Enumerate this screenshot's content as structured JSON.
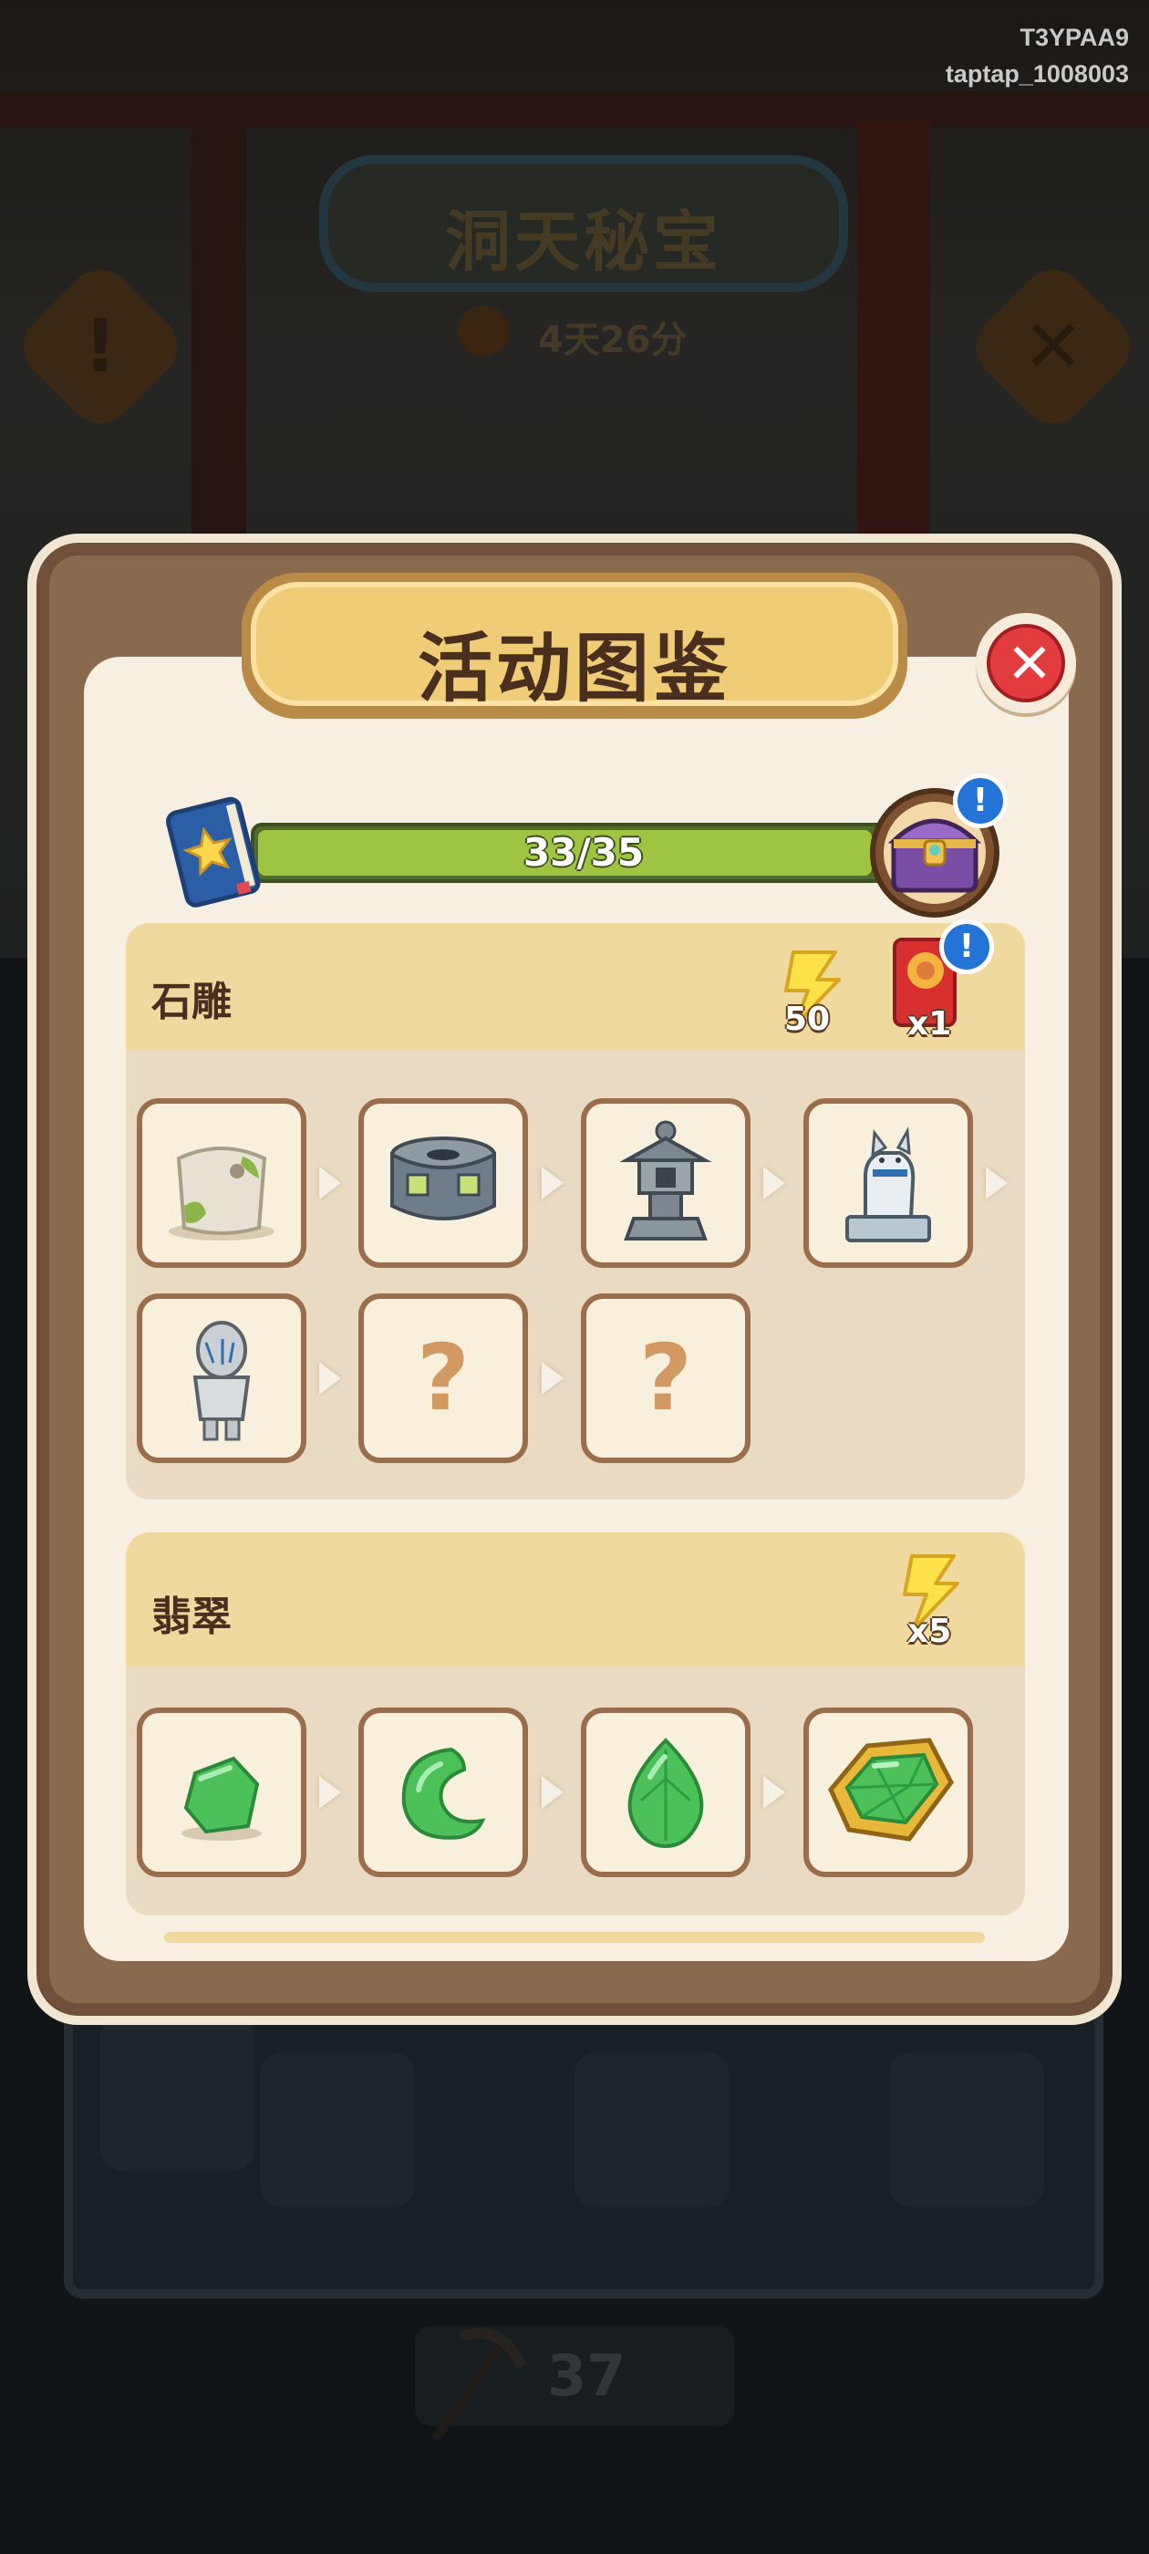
{
  "device_ids": {
    "line1": "T3YPAA9",
    "line2": "taptap_1008003"
  },
  "background": {
    "event_title": "洞天秘宝",
    "timer": "4天26分",
    "pickaxe_count": "37"
  },
  "modal": {
    "title": "活动图鉴",
    "progress": {
      "current": 33,
      "total": 35,
      "label": "33/35"
    },
    "sections": [
      {
        "name": "石雕",
        "rewards": [
          {
            "icon": "lightning-energy-icon",
            "label": "50"
          },
          {
            "icon": "red-envelope-icon",
            "label": "x1"
          }
        ],
        "items": [
          {
            "icon": "mossy-stone-block-icon",
            "unlocked": true
          },
          {
            "icon": "carved-stone-drum-icon",
            "unlocked": true
          },
          {
            "icon": "stone-lantern-icon",
            "unlocked": true
          },
          {
            "icon": "stone-dog-statue-icon",
            "unlocked": true
          },
          {
            "icon": "stone-figure-statue-icon",
            "unlocked": true
          },
          {
            "icon": "unknown-item-icon",
            "unlocked": false,
            "label": "?"
          },
          {
            "icon": "unknown-item-icon",
            "unlocked": false,
            "label": "?"
          }
        ]
      },
      {
        "name": "翡翠",
        "rewards": [
          {
            "icon": "lightning-energy-icon",
            "label": "x5"
          }
        ],
        "items": [
          {
            "icon": "jade-pebble-icon",
            "unlocked": true
          },
          {
            "icon": "jade-crescent-icon",
            "unlocked": true
          },
          {
            "icon": "jade-drop-icon",
            "unlocked": true
          },
          {
            "icon": "jade-gem-gold-setting-icon",
            "unlocked": true
          }
        ]
      }
    ]
  },
  "colors": {
    "progress_fill": "#9ec442",
    "close_red": "#e23c3e",
    "badge_blue": "#2374d6",
    "jade_green": "#4cc15a",
    "frame_brown": "#8a6a4e"
  }
}
